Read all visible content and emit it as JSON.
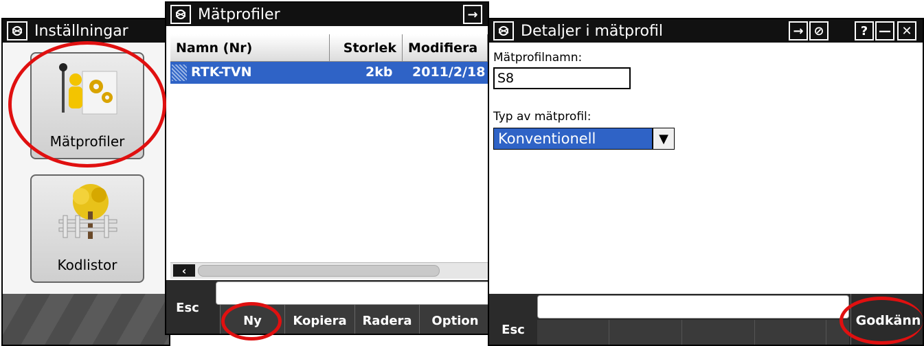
{
  "settings_window": {
    "title": "Inställningar",
    "tiles": [
      {
        "label": "Mätprofiler",
        "icon": "survey-profile-icon"
      },
      {
        "label": "Kodlistor",
        "icon": "tree-fence-icon"
      }
    ]
  },
  "profiles_window": {
    "title": "Mätprofiler",
    "title_buttons": [
      "→",
      "⊘",
      "?",
      "—",
      "✕"
    ],
    "columns": [
      "Namn (Nr)",
      "Storlek",
      "Modifiera"
    ],
    "rows": [
      {
        "name": "RTK-TVN",
        "size": "2kb",
        "modified": "2011/2/18"
      }
    ],
    "softkeys": [
      "Esc",
      "Ny",
      "Kopiera",
      "Radera",
      "Option"
    ]
  },
  "details_window": {
    "title": "Detaljer i mätprofil",
    "title_buttons": [
      "→",
      "⊘",
      "?",
      "—",
      "✕"
    ],
    "name_label": "Mätprofilnamn:",
    "name_value": "S8",
    "type_label": "Typ av mätprofil:",
    "type_value": "Konventionell",
    "softkeys": [
      "Esc",
      "Godkänn"
    ]
  },
  "colors": {
    "selection": "#2f63c6",
    "titlebar": "#111111",
    "annotation": "#e01010"
  }
}
